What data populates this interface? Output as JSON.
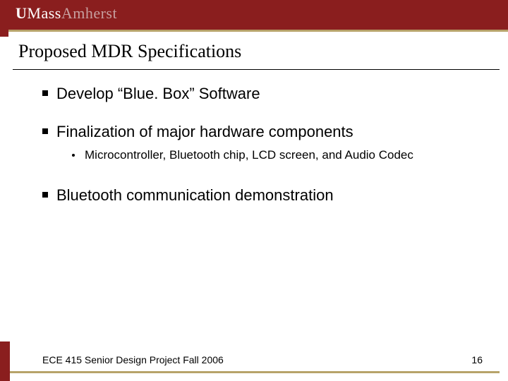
{
  "logo": {
    "u": "U",
    "mass": "Mass",
    "amherst": "Amherst"
  },
  "title": "Proposed MDR Specifications",
  "bullets": {
    "b1": "Develop “Blue. Box” Software",
    "b2": "Finalization of major hardware components",
    "b2_1": "Microcontroller, Bluetooth chip, LCD screen, and Audio Codec",
    "b3": "Bluetooth communication demonstration"
  },
  "footer": {
    "left": "ECE 415 Senior Design Project Fall 2006",
    "page": "16"
  }
}
